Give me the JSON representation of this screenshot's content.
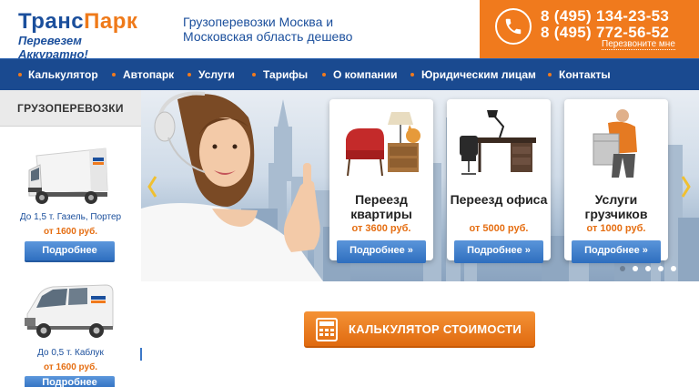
{
  "header": {
    "logo_part1": "Транс",
    "logo_part2": "Парк",
    "logo_sub": "Перевезем Аккуратно!",
    "tagline": "Грузоперевозки Москва и Московская область дешево",
    "phone1": "8 (495) 134-23-53",
    "phone2": "8 (495) 772-56-52",
    "callback": "Перезвоните мне"
  },
  "nav": {
    "items": [
      "Калькулятор",
      "Автопарк",
      "Услуги",
      "Тарифы",
      "О компании",
      "Юридическим лицам",
      "Контакты"
    ]
  },
  "sidebar": {
    "title": "ГРУЗОПЕРЕВОЗКИ",
    "items": [
      {
        "desc": "До 1,5 т. Газель, Портер",
        "price": "от 1600 руб.",
        "button": "Подробнее"
      },
      {
        "desc": "До 0,5 т. Каблук",
        "price": "от 1600 руб.",
        "button": "Подробнее"
      }
    ]
  },
  "banner": {
    "cards": [
      {
        "title": "Переезд квартиры",
        "price": "от 3600 руб.",
        "button": "Подробнее »"
      },
      {
        "title": "Переезд офиса",
        "price": "от 5000 руб.",
        "button": "Подробнее »"
      },
      {
        "title": "Услуги грузчиков",
        "price": "от 1000 руб.",
        "button": "Подробнее »"
      }
    ],
    "slide_count": 5
  },
  "calculator": {
    "label": "КАЛЬКУЛЯТОР СТОИМОСТИ"
  },
  "colors": {
    "brand_blue": "#1a4a90",
    "accent_orange": "#f07a1d",
    "price_orange": "#e56e12"
  }
}
